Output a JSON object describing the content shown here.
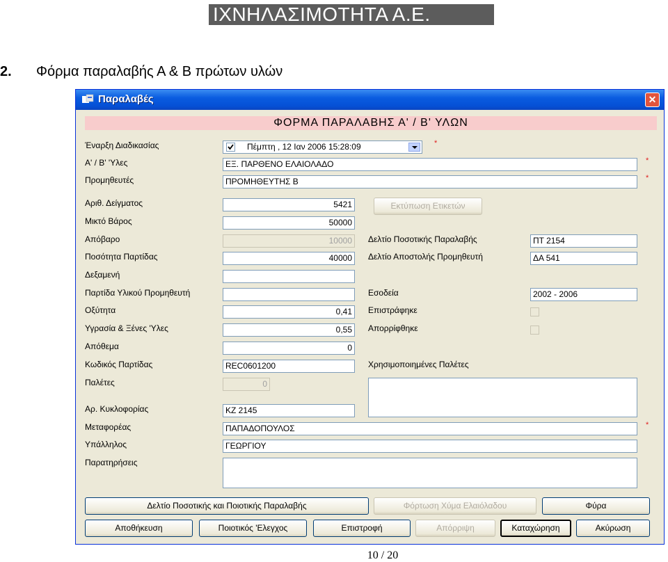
{
  "header": {
    "banner": "ΙΧΝΗΛΑΣΙΜΟΤΗΤΑ Α.Ε."
  },
  "section": {
    "number": "2.",
    "title": "Φόρμα παραλαβής Α & Β πρώτων υλών"
  },
  "window": {
    "title": "Παραλαβές",
    "close": "✕"
  },
  "form": {
    "title": "ΦΟΡΜΑ ΠΑΡΑΛΑΒΗΣ Α' / Β' ΥΛΩΝ",
    "required_mark": "*",
    "labels": {
      "start": "Έναρξη Διαδικασίας",
      "materials": "Α' / Β' 'Υλες",
      "supplier": "Προμηθευτές",
      "sample_no": "Αριθ. Δείγματος",
      "gross_weight": "Μικτό Βάρος",
      "tare": "Απόβαρο",
      "batch_qty": "Ποσότητα Παρτίδας",
      "tank": "Δεξαμενή",
      "supplier_batch": "Παρτίδα Υλικού Προμηθευτή",
      "acidity": "Οξύτητα",
      "humidity": "Υγρασία & Ξένες 'Υλες",
      "stock": "Απόθεμα",
      "batch_code": "Κωδικός Παρτίδας",
      "pallets": "Παλέτες",
      "plate_no": "Αρ. Κυκλοφορίας",
      "carrier": "Μεταφορέας",
      "employee": "Υπάλληλος",
      "notes": "Παρατηρήσεις",
      "qty_receipt": "Δελτίο Ποσοτικής Παραλαβής",
      "supplier_delivery": "Δελτίο Αποστολής Προμηθευτή",
      "fiscal_year": "Εσοδεία",
      "returned": "Επιστράφηκε",
      "rejected": "Απορρίφθηκε",
      "used_pallets": "Χρησιμοποιημένες Παλέτες"
    },
    "values": {
      "start_datetime": "Πέμπτη   , 12 Ιαν  2006  15:28:09",
      "materials": "ΕΞ. ΠΑΡΘΕΝΟ ΕΛΑΙΟΛΑΔΟ",
      "supplier": "ΠΡΟΜΗΘΕΥΤΗΣ Β",
      "sample_no": "5421",
      "gross_weight": "50000",
      "tare": "10000",
      "batch_qty": "40000",
      "tank": "",
      "supplier_batch": "",
      "acidity": "0,41",
      "humidity": "0,55",
      "stock": "0",
      "batch_code": "REC0601200",
      "pallets": "0",
      "plate_no": "ΚΖ 2145",
      "carrier": "ΠΑΠΑΔΟΠΟΥΛΟΣ",
      "employee": "ΓΕΩΡΓΙΟΥ",
      "notes": "",
      "qty_receipt": "ΠΤ 2154",
      "supplier_delivery": "ΔΑ 541",
      "fiscal_year": "2002 - 2006",
      "used_pallets": ""
    },
    "buttons": {
      "print_labels": "Εκτύπωση Ετικετών",
      "qty_quality_receipt": "Δελτίο Ποσοτικής και Ποιοτικής Παραλαβής",
      "load_bulk": "Φόρτωση Χύμα Ελαιόλαδου",
      "filter": "Φύρα",
      "save": "Αποθήκευση",
      "quality_control": "Ποιοτικός 'Ελεγχος",
      "return": "Επιστροφή",
      "reject": "Απόρριψη",
      "register": "Καταχώρηση",
      "cancel": "Ακύρωση"
    }
  },
  "footer": {
    "page": "10 / 20"
  }
}
